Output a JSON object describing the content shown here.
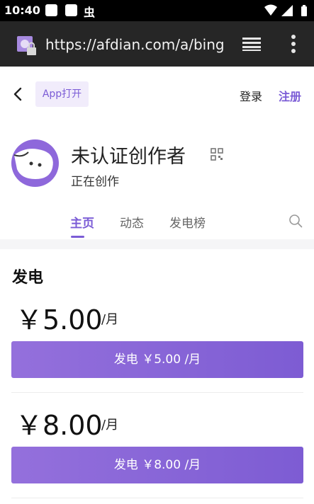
{
  "status_bar": {
    "time": "10:40",
    "bug_glyph": "虫",
    "icons": [
      "notification-icon",
      "notification-icon",
      "wifi-icon",
      "signal-icon",
      "battery-icon"
    ]
  },
  "browser": {
    "url": "https://afdian.com/a/bing",
    "site_icon": "lock-page-icon",
    "tabs_icon": "tabs-icon",
    "menu_icon": "more-vertical-icon"
  },
  "header": {
    "back_icon": "back-icon",
    "app_open_label": "App打开",
    "login_label": "登录",
    "signup_label": "注册"
  },
  "creator": {
    "name": "未认证创作者",
    "status": "正在创作",
    "avatar_color": "#8e68db",
    "qr_icon": "qr-code-icon"
  },
  "tabs": [
    {
      "label": "主页",
      "active": true
    },
    {
      "label": "动态",
      "active": false
    },
    {
      "label": "发电榜",
      "active": false
    }
  ],
  "search_icon": "search-icon",
  "plans_section": {
    "title": "发电",
    "plans": [
      {
        "price": "￥5.00",
        "period": "/月",
        "button_label": "发电 ￥5.00 /月"
      },
      {
        "price": "￥8.00",
        "period": "/月",
        "button_label": "发电 ￥8.00 /月"
      }
    ]
  },
  "colors": {
    "accent": "#7b5cd6",
    "app_open_bg": "#f1ecfb",
    "urlbar_bg": "#262626"
  }
}
